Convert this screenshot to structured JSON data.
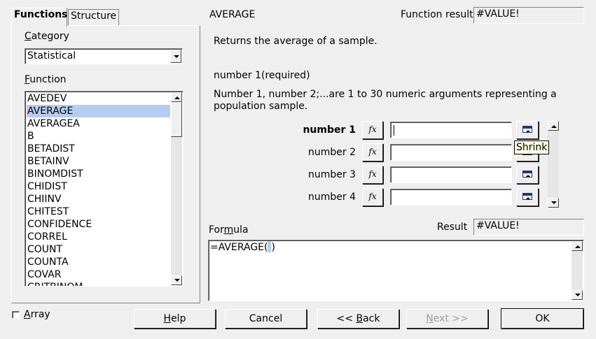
{
  "tabs": [
    {
      "label": "Functions",
      "active": true
    },
    {
      "label": "Structure",
      "active": false
    }
  ],
  "category": {
    "label_prefix": "",
    "label_underlined": "C",
    "label_rest": "ategory",
    "value": "Statistical"
  },
  "function_list": {
    "label_underlined": "F",
    "label_rest": "unction",
    "items": [
      "AVEDEV",
      "AVERAGE",
      "AVERAGEA",
      "B",
      "BETADIST",
      "BETAINV",
      "BINOMDIST",
      "CHIDIST",
      "CHIINV",
      "CHITEST",
      "CONFIDENCE",
      "CORREL",
      "COUNT",
      "COUNTA",
      "COVAR",
      "CRITBINOM"
    ],
    "selected_index": 1
  },
  "header": {
    "function_name": "AVERAGE",
    "function_result_label": "Function result",
    "function_result_value": "#VALUE!"
  },
  "description": "Returns the average of a sample.",
  "argument": {
    "title": "number 1(required)",
    "help": "Number 1, number 2;...are 1 to 30 numeric arguments representing a population sample."
  },
  "arguments": [
    {
      "name": "number 1",
      "value": "",
      "bold": true
    },
    {
      "name": "number 2",
      "value": "",
      "bold": false
    },
    {
      "name": "number 3",
      "value": "",
      "bold": false
    },
    {
      "name": "number 4",
      "value": "",
      "bold": false
    }
  ],
  "fx_glyph": "fx",
  "tooltip": "Shrink",
  "formula": {
    "label_pre": "For",
    "label_underlined": "m",
    "label_rest": "ula",
    "result_label": "Result",
    "result_value": "#VALUE!",
    "text_pre": "=AVERAGE(",
    "text_post": ")"
  },
  "array_checkbox": {
    "label_underlined": "A",
    "label_rest": "rray",
    "checked": false
  },
  "buttons": {
    "help": {
      "underlined": "H",
      "rest": "elp"
    },
    "cancel": "Cancel",
    "back": {
      "pre": "<< ",
      "underlined": "B",
      "rest": "ack"
    },
    "next": {
      "underlined": "N",
      "rest": "ext >>"
    },
    "ok": "OK"
  },
  "icons": {
    "dropdown": "chevron-down-icon",
    "shrink": "shrink-icon",
    "fx": "function-wizard-icon"
  }
}
